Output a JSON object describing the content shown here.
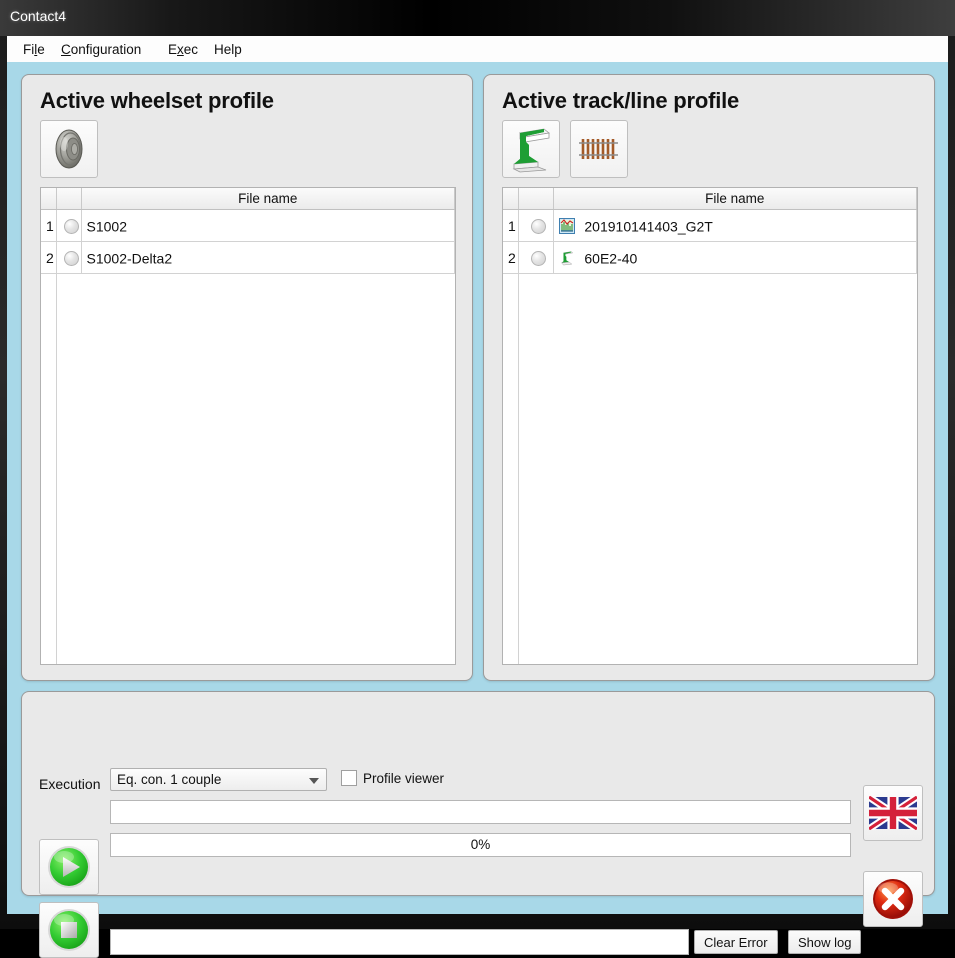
{
  "window": {
    "title": "Contact4",
    "menu": [
      {
        "label": "File",
        "mnemonic_index": 2
      },
      {
        "label": "Configuration",
        "mnemonic_index": 0
      },
      {
        "label": "Exec",
        "mnemonic_index": 1
      },
      {
        "label": "Help",
        "mnemonic_index": -1
      }
    ]
  },
  "colors": {
    "client_background": "#a8d8e8",
    "panel_background": "#e9e9e9",
    "accent_green": "#3cc03c",
    "accent_red": "#cc1f1f",
    "rail_green": "#1e9e34"
  },
  "wheelset_panel": {
    "title": "Active wheelset profile",
    "toolbar": [
      {
        "name": "wheelset-profile-button",
        "icon": "wheel-icon"
      }
    ],
    "table": {
      "columns": [
        "",
        "",
        "File name"
      ],
      "rows": [
        {
          "index": "1",
          "selected": false,
          "icon": "",
          "name": "S1002"
        },
        {
          "index": "2",
          "selected": false,
          "icon": "",
          "name": "S1002-Delta2"
        }
      ]
    }
  },
  "track_panel": {
    "title": "Active track/line profile",
    "toolbar": [
      {
        "name": "rail-profile-button",
        "icon": "rail-icon"
      },
      {
        "name": "track-layout-button",
        "icon": "track-icon"
      }
    ],
    "table": {
      "columns": [
        "",
        "",
        "File name"
      ],
      "rows": [
        {
          "index": "1",
          "selected": false,
          "icon": "measurement-icon",
          "name": "201910141403_G2T"
        },
        {
          "index": "2",
          "selected": false,
          "icon": "rail-small-icon",
          "name": "60E2-40"
        }
      ]
    }
  },
  "execution_panel": {
    "label": "Execution",
    "mode_select": {
      "value": "Eq. con. 1 couple",
      "options": [
        "Eq. con. 1 couple"
      ]
    },
    "profile_viewer": {
      "label": "Profile viewer",
      "checked": false
    },
    "status_field": {
      "value": "",
      "placeholder": ""
    },
    "progress": {
      "percent": 0,
      "text": "0%"
    },
    "error_field": {
      "value": "",
      "placeholder": ""
    },
    "buttons": {
      "play": "play-icon",
      "stop": "stop-icon",
      "language": "uk-flag-icon",
      "exit": "red-x-icon",
      "clear_error": "Clear Error",
      "show_log": "Show log"
    }
  }
}
